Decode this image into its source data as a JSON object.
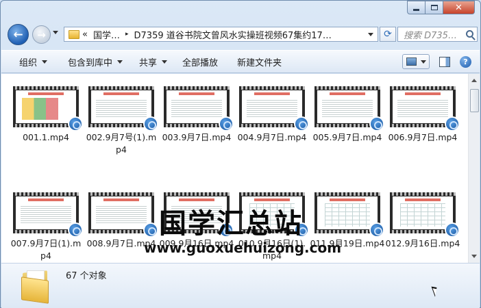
{
  "window": {
    "caption": {
      "minimize": "minimize",
      "maximize": "maximize",
      "close": "✕"
    }
  },
  "nav": {
    "back_icon": "back-arrow-icon",
    "forward_icon": "forward-arrow-icon",
    "address": {
      "overflow": "«",
      "segments": [
        "国学…",
        "D7359 道谷书院文曾风水实操班视频67集约17…"
      ],
      "separator": "▸"
    },
    "refresh_icon": "refresh-icon",
    "search_placeholder": "搜索 D735…"
  },
  "toolbar": {
    "organize": "组织",
    "include_library": "包含到库中",
    "share": "共享",
    "play_all": "全部播放",
    "new_folder": "新建文件夹"
  },
  "files": [
    {
      "name": "001.1.mp4",
      "thumb": "blocks"
    },
    {
      "name": "002.9月7号(1).mp4",
      "thumb": "lines"
    },
    {
      "name": "003.9月7日.mp4",
      "thumb": "lines"
    },
    {
      "name": "004.9月7日.mp4",
      "thumb": "lines"
    },
    {
      "name": "005.9月7日.mp4",
      "thumb": "lines"
    },
    {
      "name": "006.9月7日.mp4",
      "thumb": "lines"
    },
    {
      "name": "007.9月7日(1).mp4",
      "thumb": "lines"
    },
    {
      "name": "008.9月7日.mp4",
      "thumb": "lines"
    },
    {
      "name": "009.9月16日.mp4",
      "thumb": "lines"
    },
    {
      "name": "010.9月16日(1).mp4",
      "thumb": "grid"
    },
    {
      "name": "011.9月19日.mp4",
      "thumb": "grid"
    },
    {
      "name": "012.9月16日.mp4",
      "thumb": "grid"
    }
  ],
  "watermark": {
    "title": "国学汇总站",
    "url": "www.guoxuehuizong.com"
  },
  "details": {
    "count": "67 个对象"
  }
}
